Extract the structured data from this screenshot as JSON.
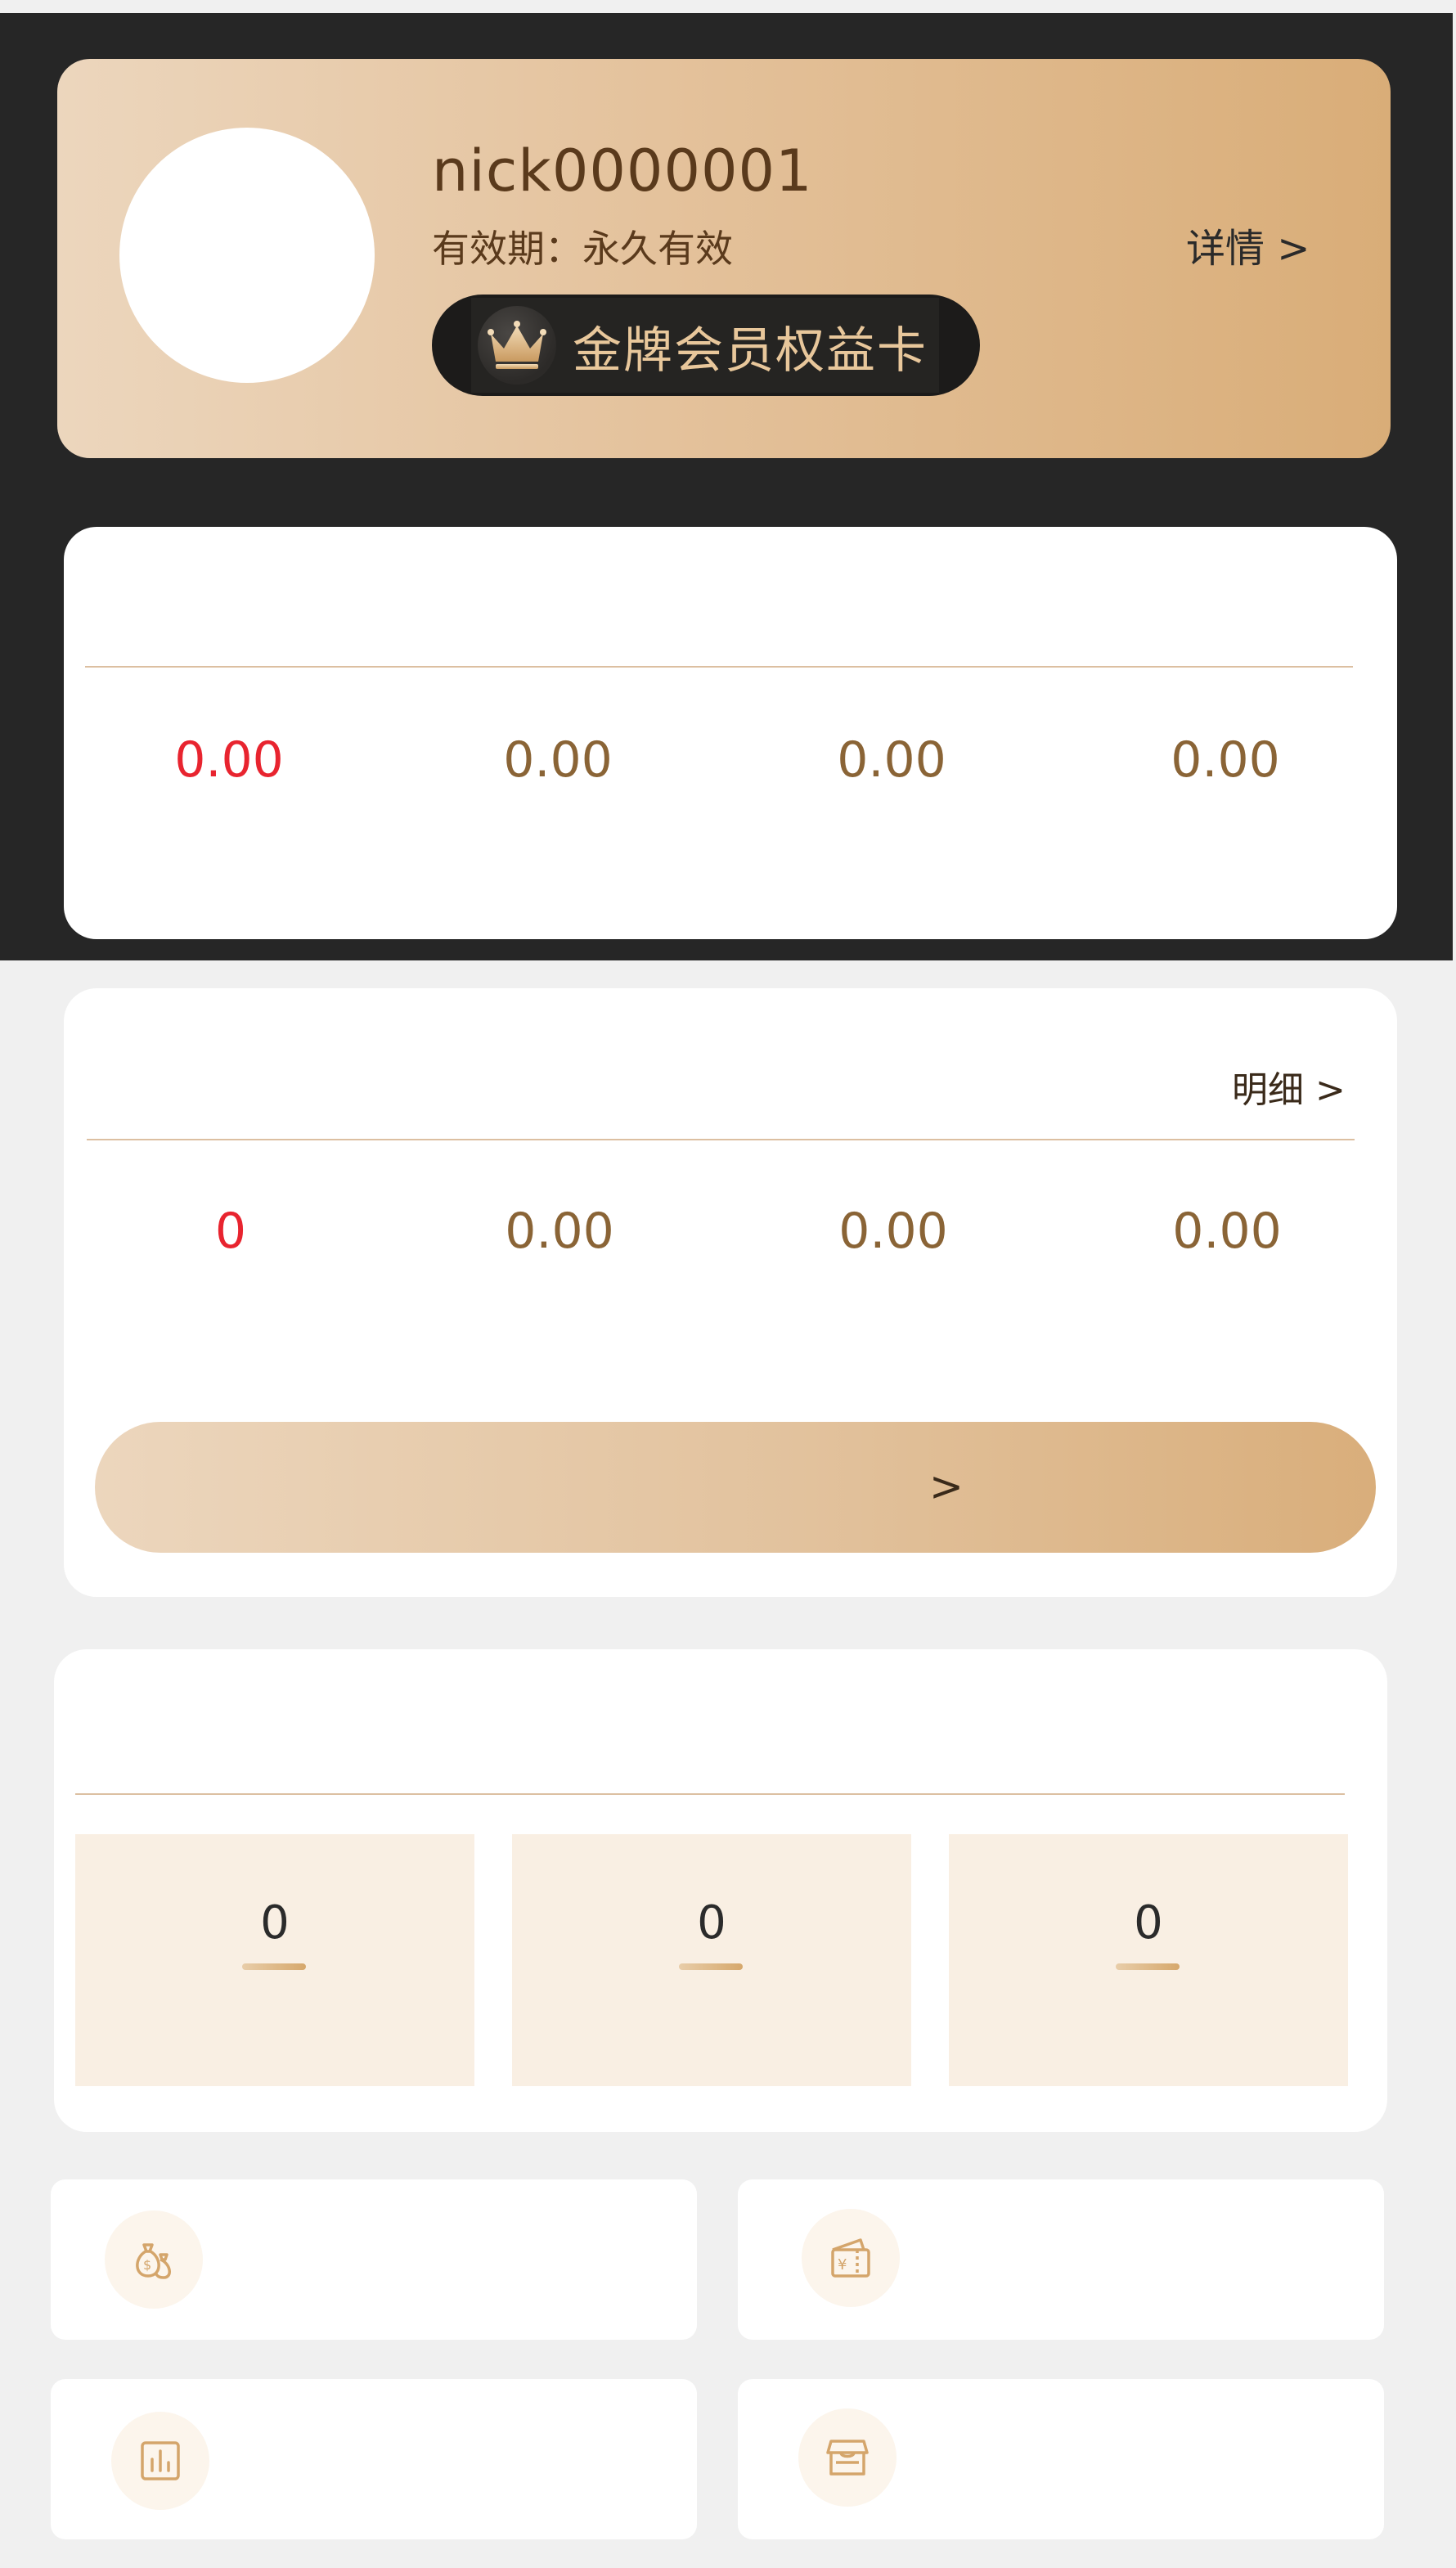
{
  "member": {
    "nickname": "nick0000001",
    "validity": "有效期：永久有效",
    "card_label": "金牌会员权益卡",
    "details_link": "详情 >"
  },
  "top_stats": {
    "values": [
      "0.00",
      "0.00",
      "0.00",
      "0.00"
    ]
  },
  "second_stats": {
    "detail_link": "明细 >",
    "values": [
      "0",
      "0.00",
      "0.00",
      "0.00"
    ],
    "button_arrow": ">"
  },
  "tiles": {
    "values": [
      "0",
      "0",
      "0"
    ]
  },
  "entries": [
    {
      "icon": "money-bag-icon"
    },
    {
      "icon": "wallet-icon"
    },
    {
      "icon": "bar-chart-icon"
    },
    {
      "icon": "store-icon"
    }
  ],
  "colors": {
    "accent_red": "#e8242f",
    "gold_text": "#8a6436",
    "dark_band": "#262626",
    "gold_gradient_start": "#ecd6bd",
    "gold_gradient_end": "#d9ad78"
  }
}
